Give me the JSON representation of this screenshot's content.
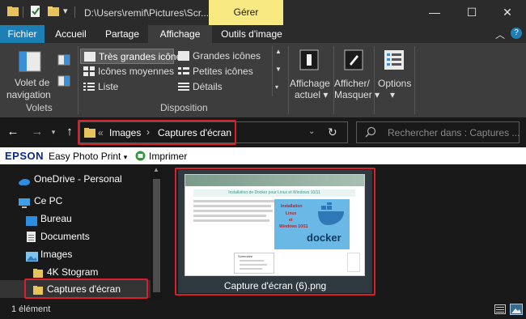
{
  "titlebar": {
    "path": "D:\\Users\\remif\\Pictures\\Scr...",
    "context_tab": "Gérer",
    "minimize": "—",
    "maximize": "☐",
    "close": "✕"
  },
  "ribbon_tabs": {
    "fichier": "Fichier",
    "accueil": "Accueil",
    "partage": "Partage",
    "affichage": "Affichage",
    "outils_image": "Outils d'image"
  },
  "ribbon": {
    "volets": {
      "button_line1": "Volet de",
      "button_line2": "navigation",
      "group": "Volets"
    },
    "disposition": {
      "group": "Disposition",
      "items": [
        "Très grandes icônes",
        "Grandes icônes",
        "Icônes moyennes",
        "Petites icônes",
        "Liste",
        "Détails"
      ]
    },
    "affichage_actuel": {
      "line1": "Affichage",
      "line2": "actuel"
    },
    "afficher_masquer": {
      "line1": "Afficher/",
      "line2": "Masquer"
    },
    "options": "Options"
  },
  "address": {
    "prefix": "«",
    "crumbs": [
      "Images",
      "Captures d'écran"
    ],
    "search_placeholder": "Rechercher dans : Captures ..."
  },
  "epson": {
    "brand": "EPSON",
    "app": "Easy Photo Print",
    "imprimer": "Imprimer"
  },
  "navpane": {
    "items": [
      "OneDrive - Personal",
      "Ce PC",
      "Bureau",
      "Documents",
      "Images",
      "4K Stogram",
      "Captures d'écran"
    ]
  },
  "content": {
    "file_name": "Capture d'écran (6).png",
    "thumb_title": "Installation de Docker pour Linux et Windows 10/11",
    "thumb_lines": [
      "Installation",
      "Linux",
      "et",
      "Windows 10/11"
    ],
    "thumb_logo": "docker",
    "thumb_box_title": "Sommaire"
  },
  "status": {
    "count": "1 élément"
  },
  "colors": {
    "accent": "#1e7fb4",
    "highlight": "#d9202a",
    "context_tab": "#f8e982"
  }
}
